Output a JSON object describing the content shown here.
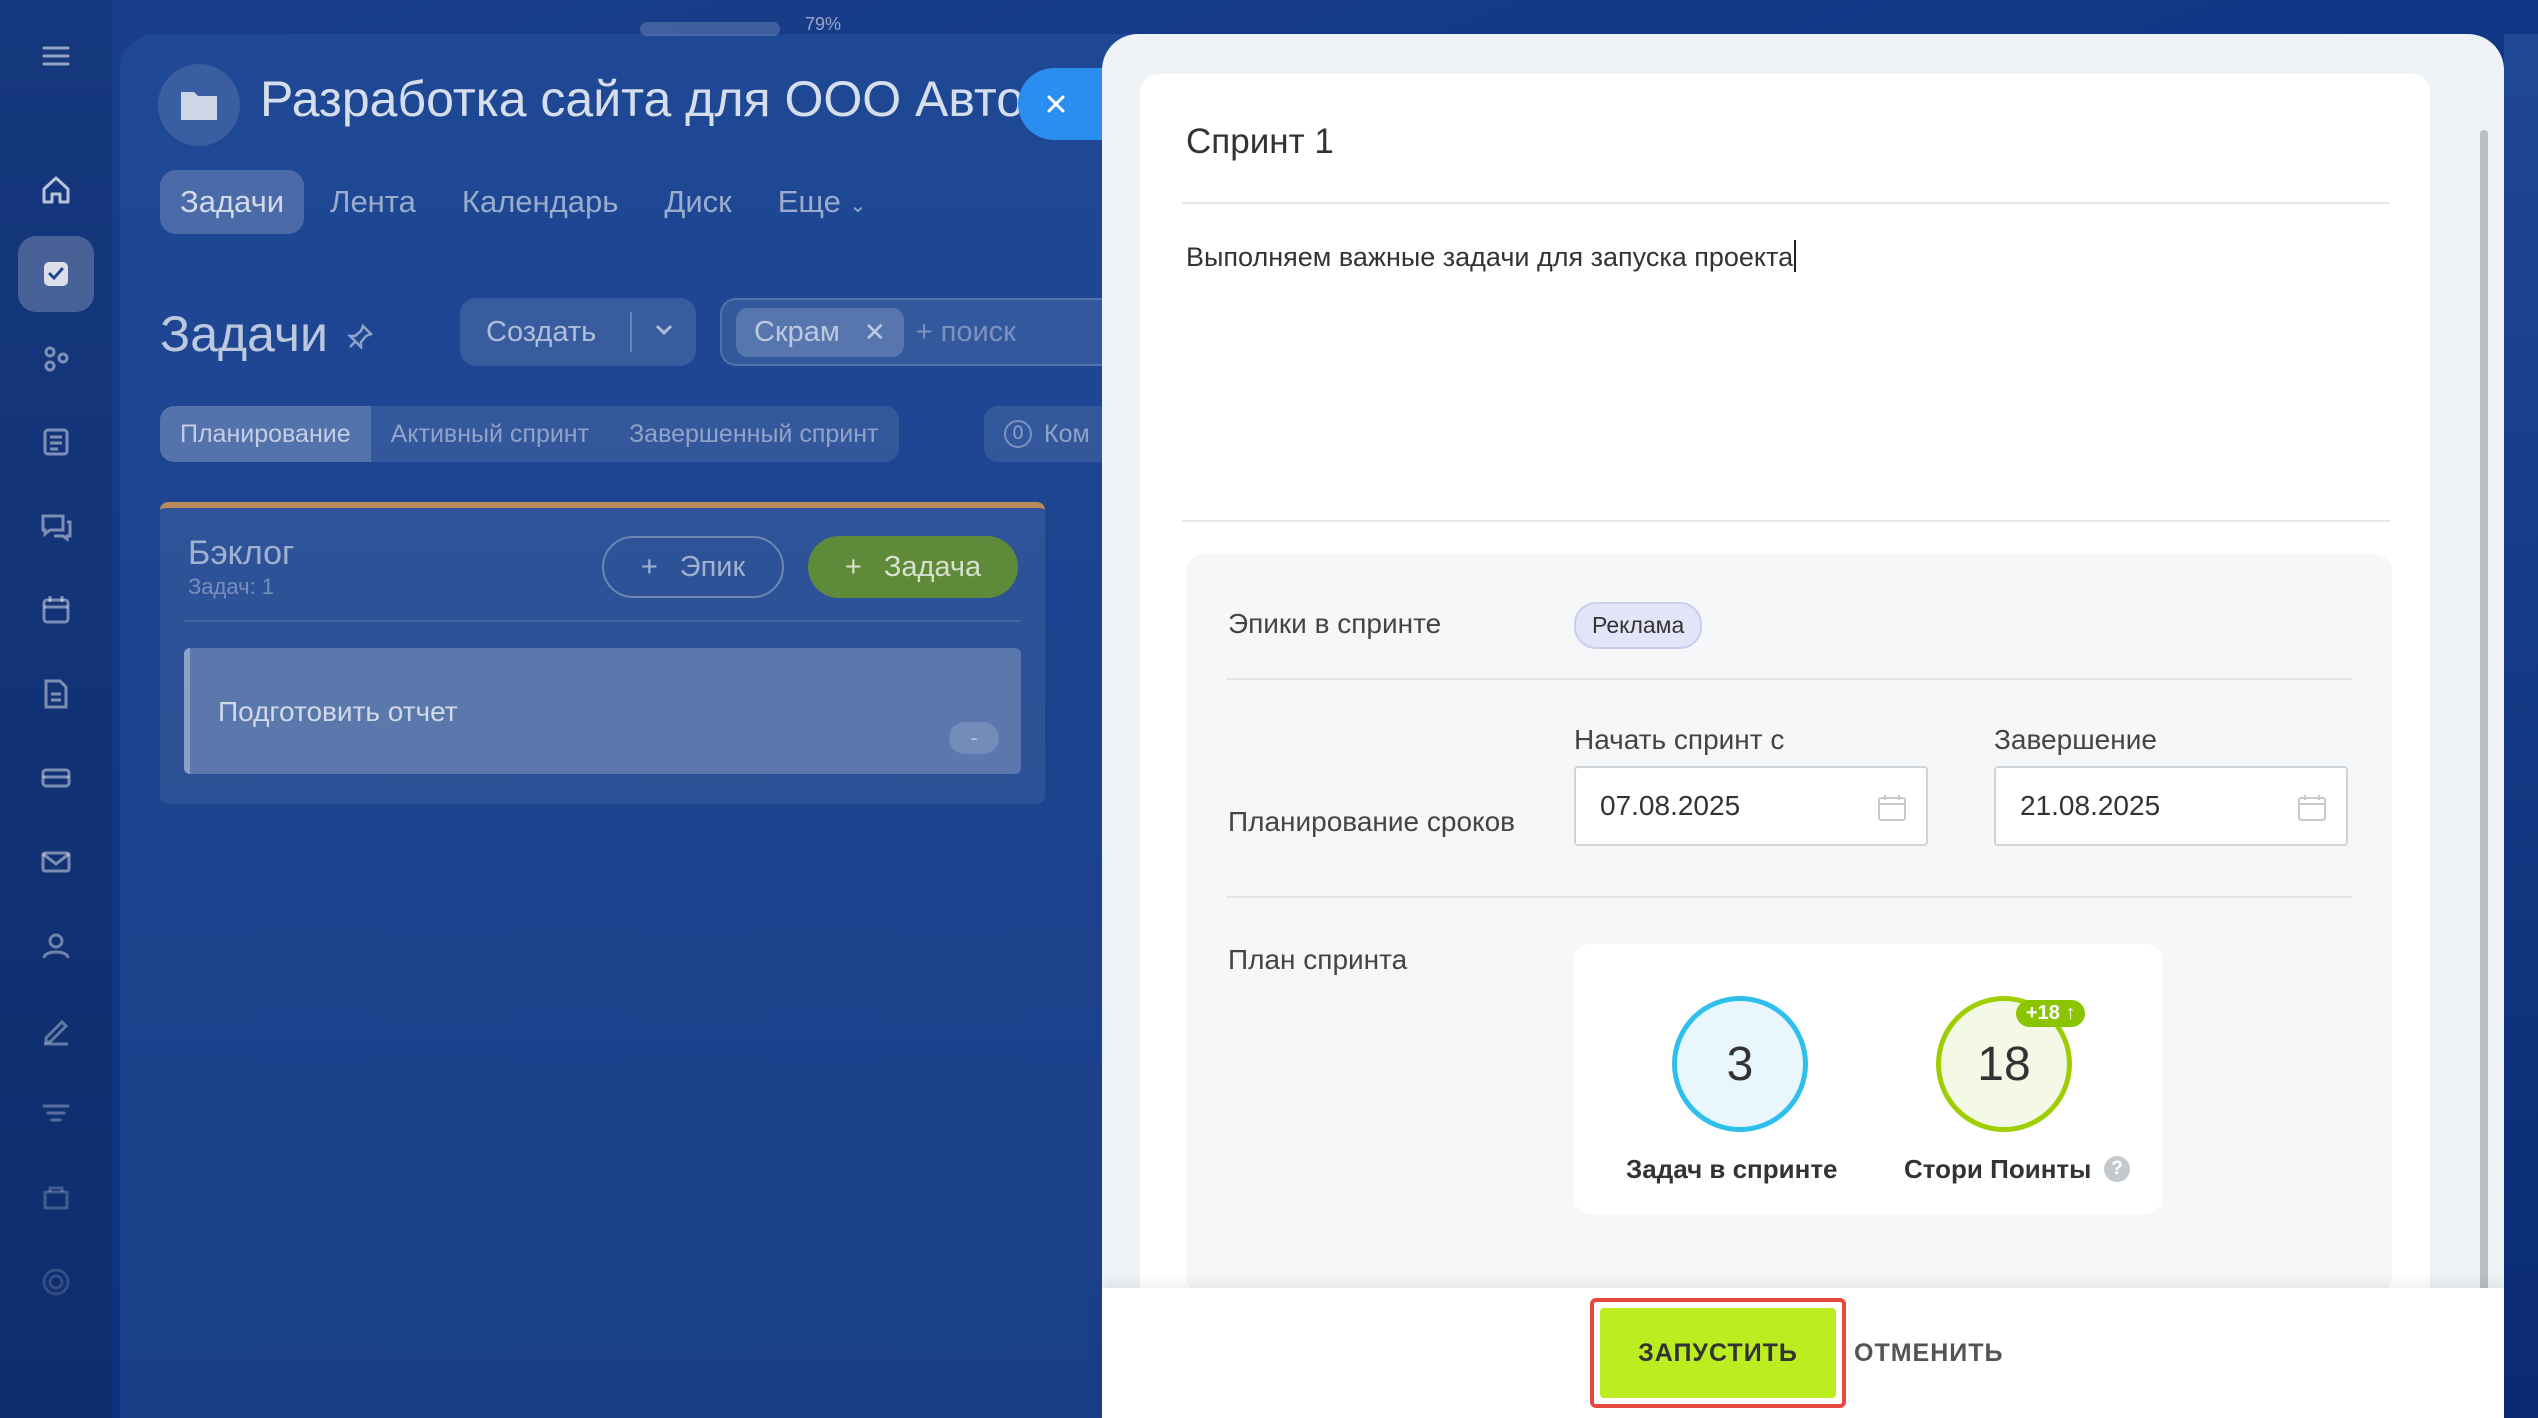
{
  "zoom": "79%",
  "sidebar": {
    "icons": [
      "menu-icon",
      "home-icon",
      "tasks-icon",
      "crm-icon",
      "feed-icon",
      "chat-icon",
      "calendar-icon",
      "docs-icon",
      "store-icon",
      "mail-icon",
      "contacts-icon",
      "sign-icon",
      "filter-icon",
      "shop-icon",
      "settings-icon"
    ]
  },
  "project": {
    "title": "Разработка сайта для ООО Автол",
    "tabs": [
      "Задачи",
      "Лента",
      "Календарь",
      "Диск",
      "Еще"
    ]
  },
  "tasks": {
    "title": "Задачи",
    "create_label": "Создать",
    "filter_chip": "Скрам",
    "search_placeholder": "+ поиск",
    "view_tabs": [
      "Планирование",
      "Активный спринт",
      "Завершенный спринт"
    ],
    "counter_num": "0",
    "counter_label": "Ком"
  },
  "backlog": {
    "title": "Бэклог",
    "count_label": "Задач: 1",
    "epic_button": "Эпик",
    "task_button": "Задача",
    "card_title": "Подготовить отчет",
    "card_badge": "-"
  },
  "sprint": {
    "name": "Спринт 1",
    "description": "Выполняем важные задачи для запуска проекта",
    "epics_label": "Эпики в спринте",
    "epic_tag": "Реклама",
    "dates_label": "Планирование сроков",
    "start_caption": "Начать спринт с",
    "start_date": "07.08.2025",
    "end_caption": "Завершение",
    "end_date": "21.08.2025",
    "plan_label": "План спринта",
    "tasks_count": "3",
    "tasks_count_label": "Задач в спринте",
    "story_points": "18",
    "story_points_delta": "+18 ↑",
    "story_points_label": "Стори Поинты",
    "help": "?"
  },
  "footer": {
    "launch_label": "ЗАПУСТИТЬ",
    "cancel_label": "ОТМЕНИТЬ"
  },
  "colors": {
    "accent_blue": "#2a8ef0",
    "launch_green": "#bbed21",
    "highlight_red": "#e8473d",
    "circle_blue": "#2ec0ea",
    "circle_green": "#9dcf00"
  }
}
